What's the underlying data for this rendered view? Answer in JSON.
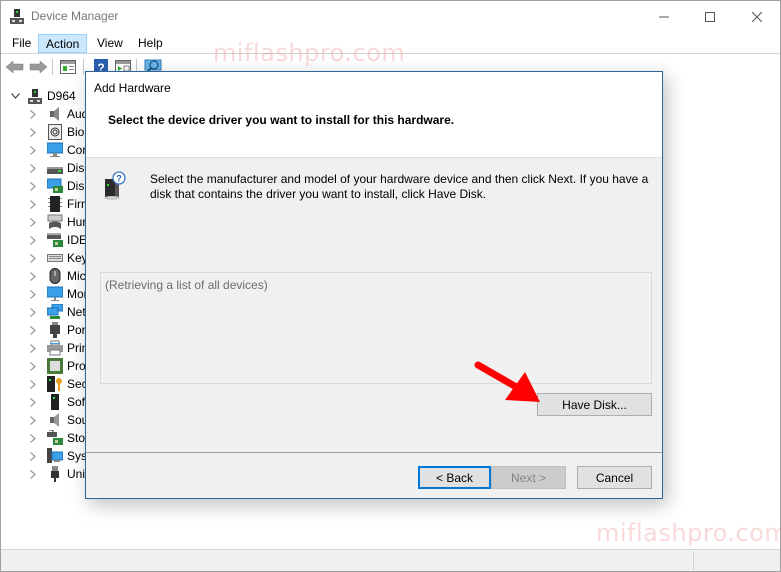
{
  "window": {
    "title": "Device Manager",
    "controls": {
      "minimize": "—",
      "maximize": "☐",
      "close": "✕"
    }
  },
  "menubar": {
    "items": [
      {
        "label": "File",
        "active": false
      },
      {
        "label": "Action",
        "active": true
      },
      {
        "label": "View",
        "active": false
      },
      {
        "label": "Help",
        "active": false
      }
    ]
  },
  "toolbar": {
    "buttons": [
      "back-arrow-icon",
      "forward-arrow-icon",
      "properties-icon",
      "help-icon",
      "update-driver-icon",
      "scan-hardware-icon"
    ]
  },
  "tree": {
    "root": {
      "label": "D964",
      "expanded": true
    },
    "items": [
      {
        "label": "Aud",
        "icon": "audio-icon"
      },
      {
        "label": "Bior",
        "icon": "biometric-icon"
      },
      {
        "label": "Cor",
        "icon": "computer-icon"
      },
      {
        "label": "Disk",
        "icon": "disk-drive-icon"
      },
      {
        "label": "Disp",
        "icon": "display-adapter-icon"
      },
      {
        "label": "Firm",
        "icon": "firmware-icon"
      },
      {
        "label": "Hur",
        "icon": "hid-icon"
      },
      {
        "label": "IDE",
        "icon": "ide-controller-icon"
      },
      {
        "label": "Key",
        "icon": "keyboard-icon"
      },
      {
        "label": "Mic",
        "icon": "mouse-icon"
      },
      {
        "label": "Mor",
        "icon": "monitor-icon"
      },
      {
        "label": "Net",
        "icon": "network-adapter-icon"
      },
      {
        "label": "Port",
        "icon": "port-icon"
      },
      {
        "label": "Prin",
        "icon": "printer-icon"
      },
      {
        "label": "Proc",
        "icon": "processor-icon"
      },
      {
        "label": "Secu",
        "icon": "security-device-icon"
      },
      {
        "label": "Soft",
        "icon": "software-device-icon"
      },
      {
        "label": "Sou",
        "icon": "sound-icon"
      },
      {
        "label": "Stor",
        "icon": "storage-controller-icon"
      },
      {
        "label": "Syst",
        "icon": "system-device-icon"
      },
      {
        "label": "Univ",
        "icon": "usb-controller-icon"
      }
    ]
  },
  "watermark": "miflashpro.com",
  "dialog": {
    "title": "Add Hardware",
    "heading": "Select the device driver you want to install for this hardware.",
    "description": "Select the manufacturer and model of your hardware device and then click Next. If you have a disk that contains the driver you want to install, click Have Disk.",
    "list_status": "(Retrieving a list of all devices)",
    "buttons": {
      "have_disk": "Have Disk...",
      "back": "< Back",
      "next": "Next >",
      "cancel": "Cancel"
    },
    "next_enabled": false
  },
  "annotation": {
    "arrow_color": "#ff0000",
    "target": "Have Disk..."
  },
  "colors": {
    "accent": "#0078d7",
    "dialog_border": "#2f6497",
    "menu_highlight": "#cce8ff"
  }
}
